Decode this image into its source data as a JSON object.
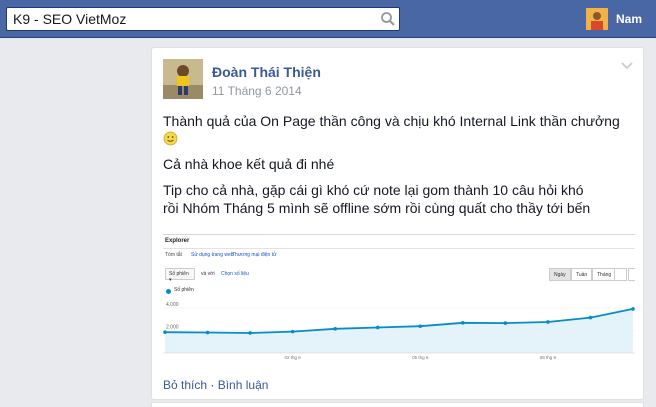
{
  "search": {
    "value": "K9 - SEO VietMoz"
  },
  "header": {
    "user_name": "Nam"
  },
  "post": {
    "author": "Đoàn Thái Thiện",
    "date": "11 Tháng 6 2014",
    "line1": "Thành quả của On Page thần công và chịu khó Internal Link thần chưởng",
    "line2": "Cả nhà khoe kết quả đi nhé",
    "line3": "Tip cho cả nhà, gặp cái gì khó cứ note lại gom thành 10 câu hỏi khó",
    "line4": "rồi Nhóm Tháng 5 mình sẽ offline sớm rồi cùng quất cho thầy tới bến"
  },
  "screenshot": {
    "title": "Explorer",
    "tabs": [
      "Tóm tắt",
      "Sử dụng trang web",
      "Thương mại điện tử"
    ],
    "metric_select": "Số phiên",
    "vs_label": "và với",
    "choose_metric": "Chọn số liệu",
    "segments": [
      "Ngày",
      "Tuần",
      "Tháng"
    ],
    "legend": "Số phiên",
    "chart_data": {
      "type": "line",
      "series": [
        {
          "name": "Số phiên",
          "values": [
            1850,
            1820,
            1780,
            1900,
            2150,
            2270,
            2380,
            2680,
            2660,
            2760,
            3150,
            3920
          ]
        }
      ],
      "x_labels": [
        "",
        "",
        "",
        "02 thg 6",
        "",
        "",
        "05 thg 6",
        "",
        "",
        "08 thg 6",
        "",
        ""
      ],
      "y_ticks": [
        2000,
        4000
      ],
      "y_tick_labels": [
        "2.000",
        "4.000"
      ],
      "ylim": [
        0,
        4800
      ]
    },
    "colors": {
      "line": "#058dc7",
      "fill": "#e4f2fa"
    }
  },
  "actions": {
    "like": "Bỏ thích",
    "sep": " · ",
    "comment": "Bình luận"
  }
}
